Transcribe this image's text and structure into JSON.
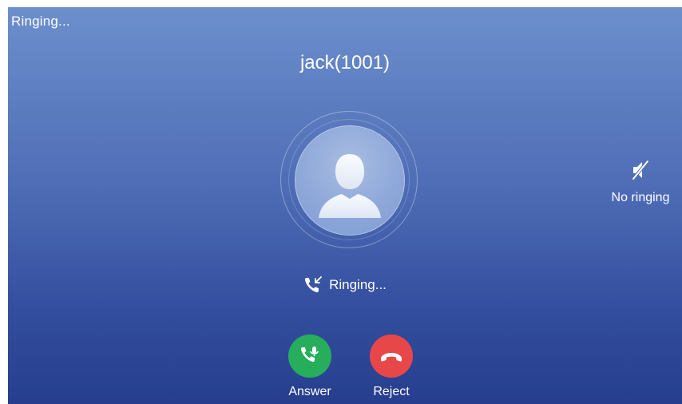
{
  "status": {
    "label": "Ringing..."
  },
  "caller": {
    "name": "jack(1001)",
    "avatar_icon": "person-silhouette-icon"
  },
  "call_state": {
    "icon": "incoming-call-icon",
    "text": "Ringing..."
  },
  "mute_toggle": {
    "icon": "speaker-muted-icon",
    "label": "No ringing"
  },
  "actions": {
    "answer": {
      "label": "Answer",
      "icon": "phone-answer-icon",
      "color": "#27ae5c"
    },
    "reject": {
      "label": "Reject",
      "icon": "phone-hangup-icon",
      "color": "#e8474a"
    }
  }
}
